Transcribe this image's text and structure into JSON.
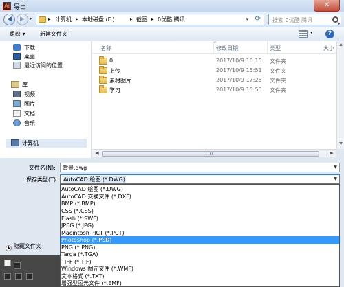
{
  "window": {
    "title": "导出",
    "app_icon": "Ai",
    "close_glyph": "✕"
  },
  "navbar": {
    "breadcrumbs": [
      "计算机",
      "本地磁盘 (F:)",
      "截图",
      "0优酷 腾讯"
    ],
    "separator": "▸",
    "search_placeholder": "搜索 0优酷 腾讯"
  },
  "toolbar": {
    "organize": "组织 ▾",
    "new_folder": "新建文件夹"
  },
  "sidebar": {
    "favorites": [
      {
        "label": "下载",
        "icon": "download-icon"
      },
      {
        "label": "桌面",
        "icon": "desktop-icon"
      },
      {
        "label": "最近访问的位置",
        "icon": "recent-places-icon"
      }
    ],
    "library": {
      "label": "库",
      "items": [
        {
          "label": "视频",
          "icon": "video-icon"
        },
        {
          "label": "图片",
          "icon": "picture-icon"
        },
        {
          "label": "文档",
          "icon": "document-icon"
        },
        {
          "label": "音乐",
          "icon": "music-icon"
        }
      ]
    },
    "computer": {
      "label": "计算机",
      "icon": "computer-icon"
    }
  },
  "file_list": {
    "columns": {
      "name": "名称",
      "date": "修改日期",
      "type": "类型",
      "size": "大小"
    },
    "rows": [
      {
        "name": "0",
        "date": "2017/10/9 10:15",
        "type": "文件夹"
      },
      {
        "name": "上传",
        "date": "2017/10/9 15:51",
        "type": "文件夹"
      },
      {
        "name": "素材图片",
        "date": "2017/10/9 17:25",
        "type": "文件夹"
      },
      {
        "name": "学习",
        "date": "2017/10/9 15:50",
        "type": "文件夹"
      }
    ]
  },
  "form": {
    "filename_label": "文件名(N):",
    "filename_value": "背景.dwg",
    "filetype_label": "保存类型(T):",
    "filetype_value": "AutoCAD 绘图 (*.DWG)",
    "hide_folders": "隐藏文件夹"
  },
  "filetype_options": [
    {
      "label": "AutoCAD 绘图 (*.DWG)",
      "selected": false
    },
    {
      "label": "AutoCAD 交换文件 (*.DXF)",
      "selected": false
    },
    {
      "label": "BMP (*.BMP)",
      "selected": false
    },
    {
      "label": "CSS (*.CSS)",
      "selected": false
    },
    {
      "label": "Flash (*.SWF)",
      "selected": false
    },
    {
      "label": "JPEG (*.JPG)",
      "selected": false
    },
    {
      "label": "Macintosh PICT (*.PCT)",
      "selected": false
    },
    {
      "label": "Photoshop (*.PSD)",
      "selected": true
    },
    {
      "label": "PNG (*.PNG)",
      "selected": false
    },
    {
      "label": "Targa (*.TGA)",
      "selected": false
    },
    {
      "label": "TIFF (*.TIF)",
      "selected": false
    },
    {
      "label": "Windows 图元文件 (*.WMF)",
      "selected": false
    },
    {
      "label": "文本格式 (*.TXT)",
      "selected": false
    },
    {
      "label": "增强型图元文件 (*.EMF)",
      "selected": false
    }
  ],
  "colors": {
    "selection": "#3399ff",
    "folder": "#e6bc4c",
    "dialog_bg": "#dfe7f1"
  }
}
